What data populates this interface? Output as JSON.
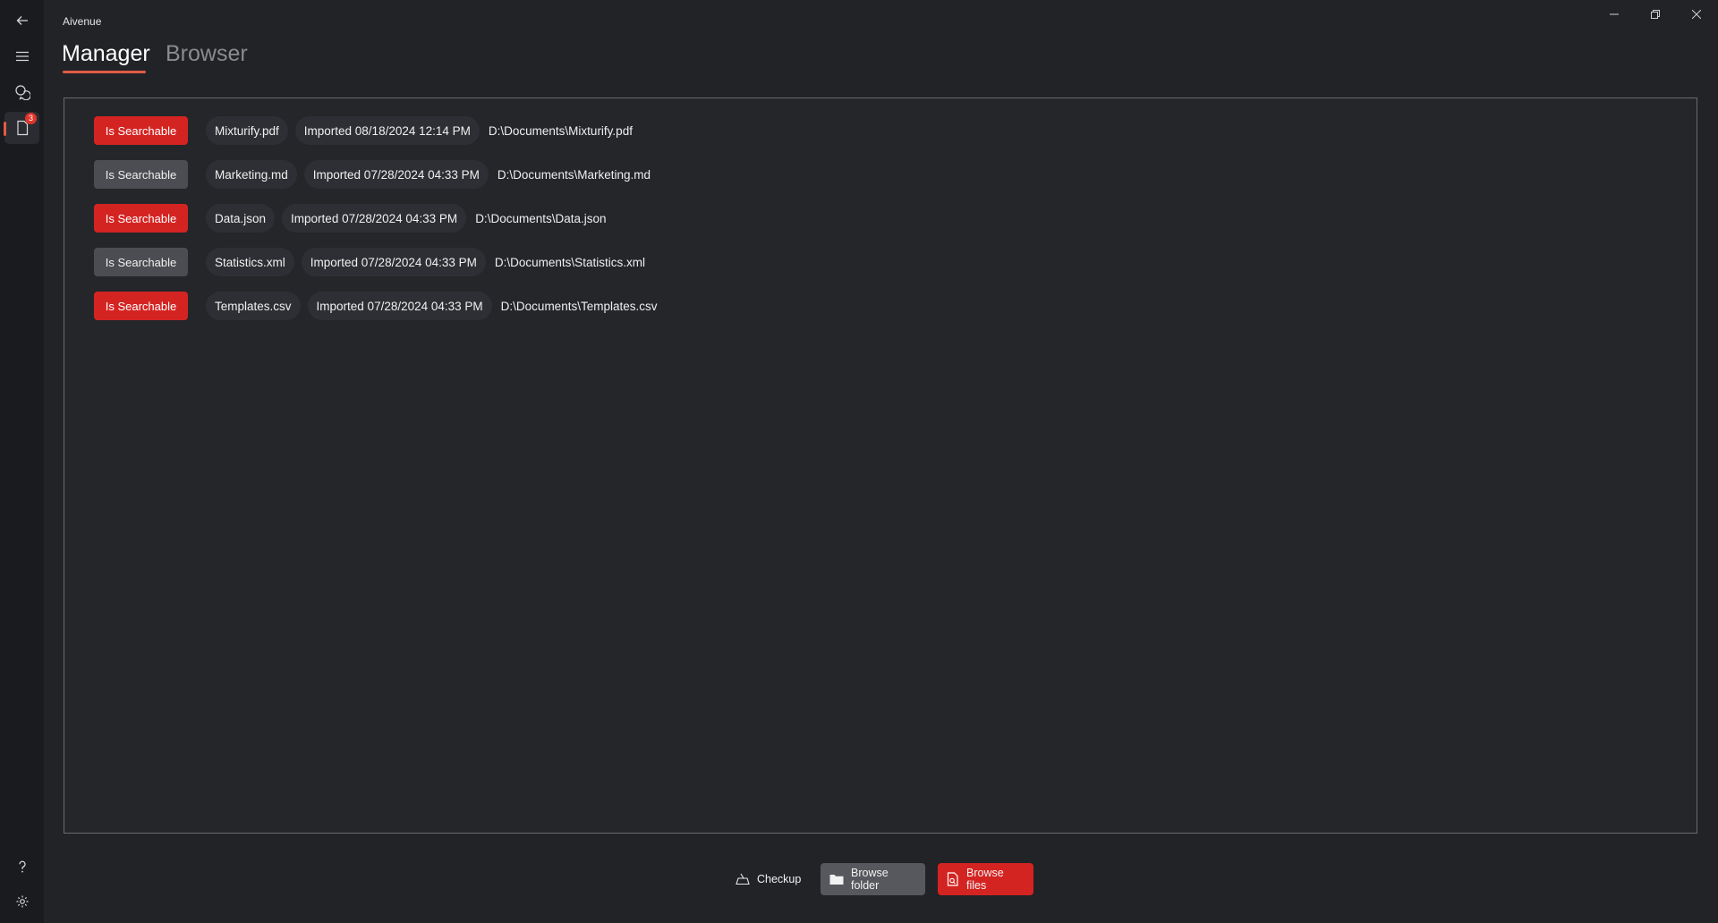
{
  "app": {
    "title": "Aivenue"
  },
  "nav": {
    "doc_badge": "3"
  },
  "tabs": [
    {
      "label": "Manager",
      "active": true
    },
    {
      "label": "Browser",
      "active": false
    }
  ],
  "documents": [
    {
      "searchable_label": "Is Searchable",
      "searchable": true,
      "name": "Mixturify.pdf",
      "imported": "Imported 08/18/2024 12:14 PM",
      "path": "D:\\Documents\\Mixturify.pdf"
    },
    {
      "searchable_label": "Is Searchable",
      "searchable": false,
      "name": "Marketing.md",
      "imported": "Imported 07/28/2024 04:33 PM",
      "path": "D:\\Documents\\Marketing.md"
    },
    {
      "searchable_label": "Is Searchable",
      "searchable": true,
      "name": "Data.json",
      "imported": "Imported 07/28/2024 04:33 PM",
      "path": "D:\\Documents\\Data.json"
    },
    {
      "searchable_label": "Is Searchable",
      "searchable": false,
      "name": "Statistics.xml",
      "imported": "Imported 07/28/2024 04:33 PM",
      "path": "D:\\Documents\\Statistics.xml"
    },
    {
      "searchable_label": "Is Searchable",
      "searchable": true,
      "name": "Templates.csv",
      "imported": "Imported 07/28/2024 04:33 PM",
      "path": "D:\\Documents\\Templates.csv"
    }
  ],
  "footer": {
    "checkup_label": "Checkup",
    "browse_folder_label": "Browse folder",
    "browse_files_label": "Browse files"
  },
  "colors": {
    "accent": "#e25b45",
    "searchable_on": "#d42422",
    "searchable_off": "#4c4d52",
    "background": "#222327"
  }
}
